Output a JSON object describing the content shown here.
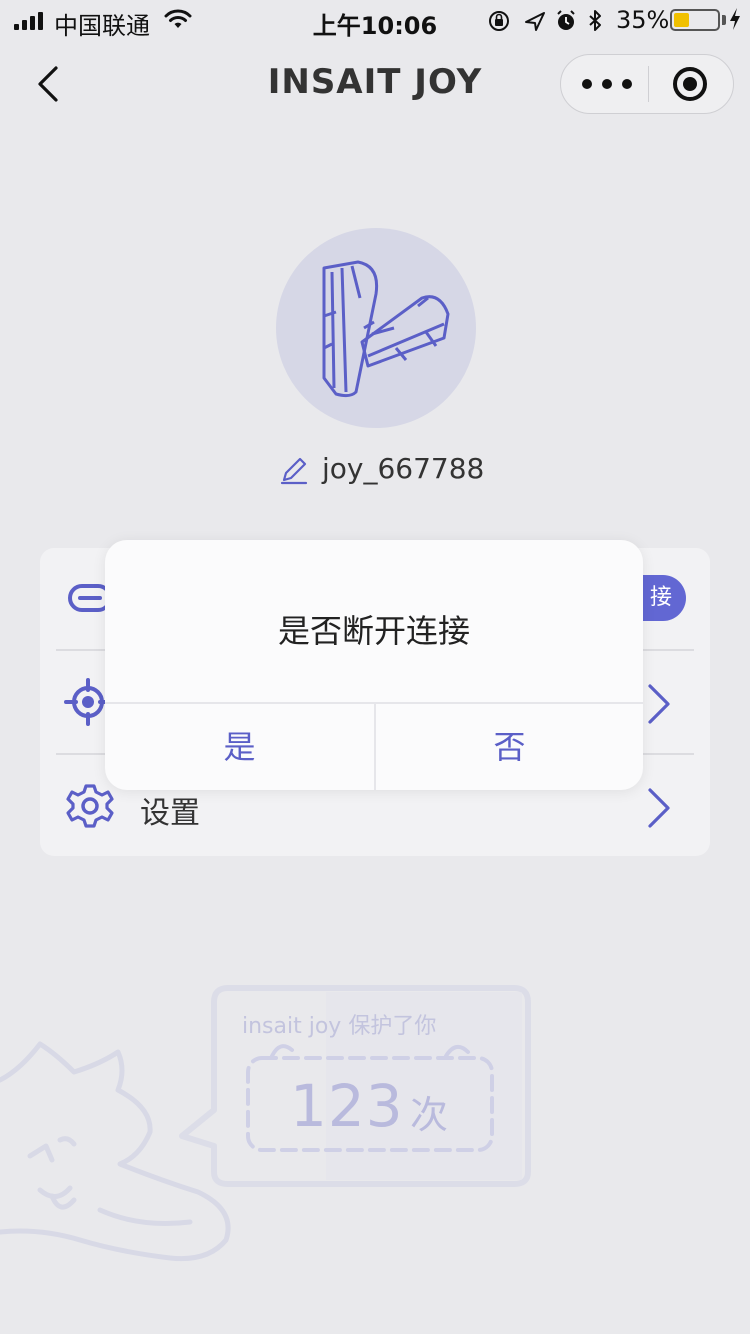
{
  "status_bar": {
    "carrier": "中国联通",
    "time": "上午10:06",
    "battery_percent": "35%",
    "battery_level": 0.35
  },
  "nav": {
    "title": "INSAIT JOY"
  },
  "profile": {
    "username": "joy_667788"
  },
  "menu": {
    "connect_pill_text": "接",
    "settings_label": "设置"
  },
  "dialog": {
    "title": "是否断开连接",
    "yes_label": "是",
    "no_label": "否"
  },
  "stats": {
    "title": "insait joy 保护了你",
    "count": "123",
    "unit": "次"
  },
  "colors": {
    "accent": "#5b5fc7",
    "background": "#e9e9ec",
    "card": "#f2f2f4",
    "battery": "#f0c000"
  }
}
